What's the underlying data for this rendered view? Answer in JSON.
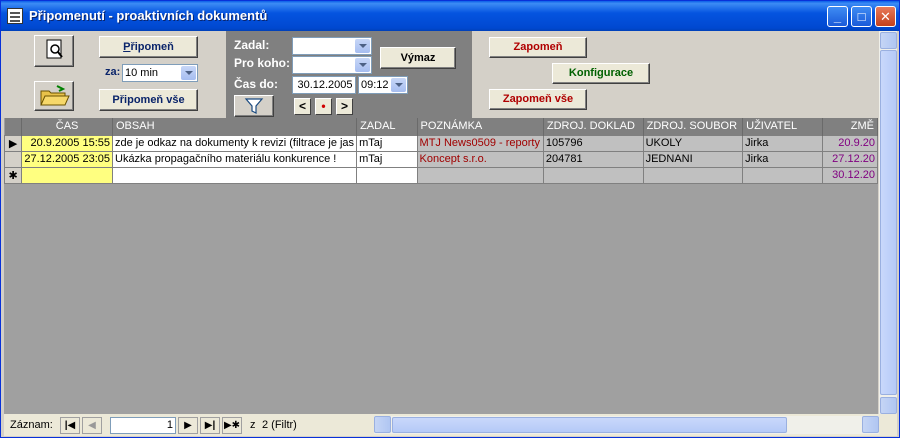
{
  "window": {
    "title": "Připomenutí - proaktivních dokumentů",
    "controls": {
      "minimize": "_",
      "maximize": "□",
      "close": "✕"
    }
  },
  "header": {
    "remind_label": "Připomeň",
    "remind_accel": "P",
    "interval_label": "za:",
    "interval_value": "10 min",
    "remind_all_label": "Připomeň vše",
    "zadal_label": "Zadal:",
    "zadal_value": "",
    "pro_koho_label": "Pro koho:",
    "pro_koho_value": "",
    "cas_do_label": "Čas do:",
    "date_value": "30.12.2005",
    "time_value": "09:12",
    "clear_label": "Výmaz",
    "nav_prev": "<",
    "nav_dot": "•",
    "nav_next": ">",
    "forget_label": "Zapomeň",
    "config_label": "Konfigurace",
    "forget_all_label": "Zapomeň vše"
  },
  "grid": {
    "columns": [
      "ČAS",
      "OBSAH",
      "ZADAL",
      "POZNÁMKA",
      "ZDROJ. DOKLAD",
      "ZDROJ. SOUBOR",
      "UŽIVATEL",
      "ZMĚ"
    ],
    "rows": [
      {
        "selector": "▶",
        "cas": "20.9.2005 15:55",
        "obsah": "zde je odkaz na dokumenty k revizi (filtrace je jas",
        "zadal": "mTaj",
        "poznamka": "MTJ News0509 - reporty",
        "doklad": "105796",
        "soubor": "UKOLY",
        "uzivatel": "Jirka",
        "zmena": "20.9.20"
      },
      {
        "selector": "",
        "cas": "27.12.2005 23:05",
        "obsah": "Ukázka propagačního materiálu konkurence !",
        "zadal": "mTaj",
        "poznamka": "Koncept s.r.o.",
        "doklad": "204781",
        "soubor": "JEDNANI",
        "uzivatel": "Jirka",
        "zmena": "27.12.20"
      },
      {
        "selector": "✱",
        "cas": "",
        "obsah": "",
        "zadal": "",
        "poznamka": "",
        "doklad": "",
        "soubor": "",
        "uzivatel": "",
        "zmena": "30.12.20"
      }
    ]
  },
  "statusbar": {
    "record_label": "Záznam:",
    "record_value": "1",
    "of_label": "z",
    "total": "2 (Filtr)"
  }
}
